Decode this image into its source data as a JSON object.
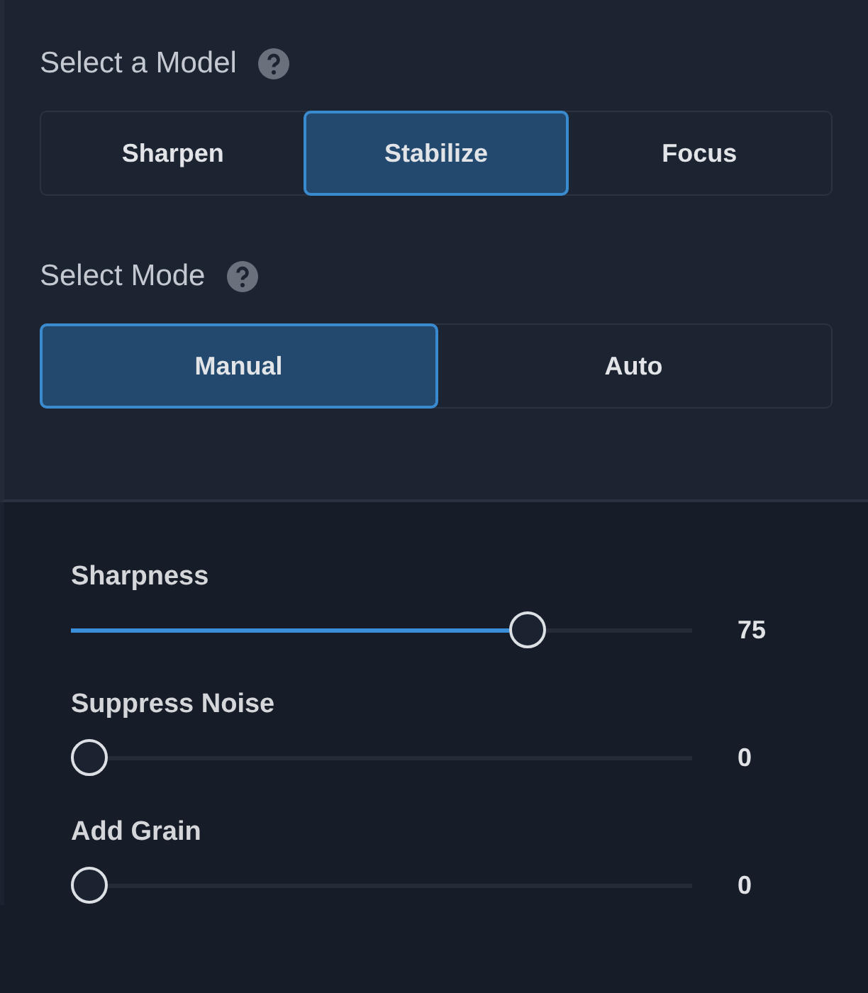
{
  "model_section": {
    "title": "Select a Model",
    "options": [
      {
        "label": "Sharpen",
        "selected": false
      },
      {
        "label": "Stabilize",
        "selected": true
      },
      {
        "label": "Focus",
        "selected": false
      }
    ]
  },
  "mode_section": {
    "title": "Select Mode",
    "options": [
      {
        "label": "Manual",
        "selected": true
      },
      {
        "label": "Auto",
        "selected": false
      }
    ]
  },
  "sliders": [
    {
      "name": "Sharpness",
      "level": 0.75,
      "reading": "75"
    },
    {
      "name": "Suppress Noise",
      "level": 0,
      "reading": "0"
    },
    {
      "name": "Add Grain",
      "level": 0,
      "reading": "0"
    }
  ]
}
